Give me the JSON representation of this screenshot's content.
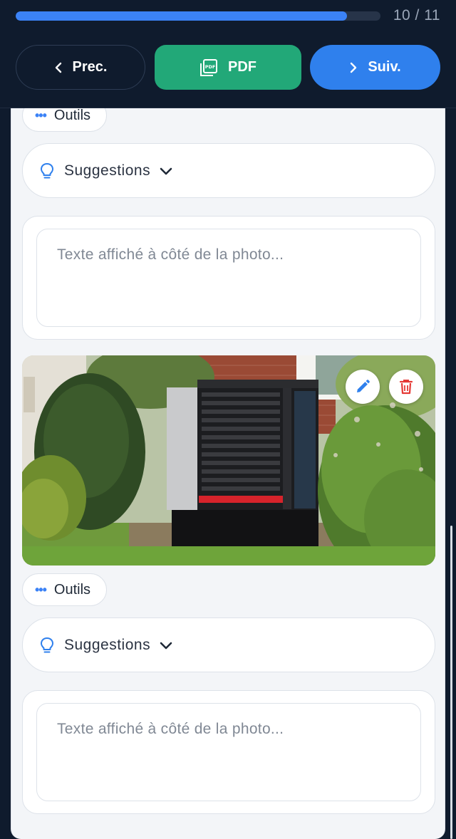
{
  "header": {
    "progress": {
      "current": 10,
      "total": 11,
      "label": "10 / 11"
    },
    "prev_label": "Prec.",
    "pdf_label": "PDF",
    "next_label": "Suiv."
  },
  "section_top": {
    "tools_label": "Outils",
    "suggestions_label": "Suggestions",
    "caption_placeholder": "Texte affiché à côté de la photo..."
  },
  "photo": {
    "subject": "outdoor heat pump unit in garden",
    "edit_icon": "pencil-icon",
    "delete_icon": "trash-icon"
  },
  "section_bottom": {
    "tools_label": "Outils",
    "suggestions_label": "Suggestions",
    "caption_placeholder": "Texte affiché à côté de la photo..."
  },
  "colors": {
    "primary": "#2f80ed",
    "pdf_green": "#22a878",
    "delete_red": "#e53935",
    "header_bg": "#0f1b2d"
  }
}
